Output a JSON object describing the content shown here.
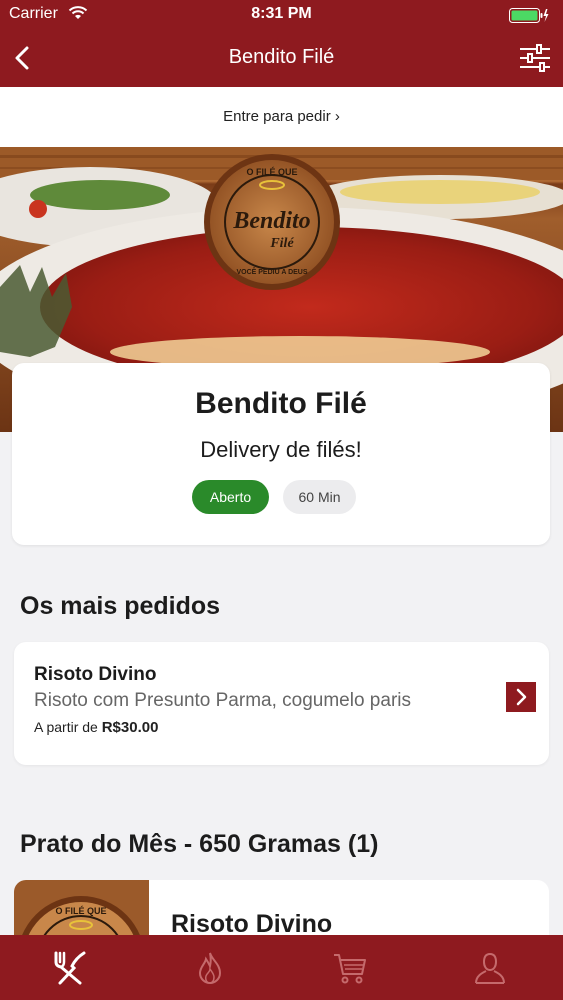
{
  "status_bar": {
    "carrier": "Carrier",
    "time": "8:31 PM"
  },
  "nav": {
    "title": "Bendito Filé",
    "back_icon": "chevron-left-icon",
    "filter_icon": "sliders-icon"
  },
  "login_prompt": "Entre para pedir ›",
  "hero": {
    "logo_top": "O FILÉ QUE",
    "logo_main": "Bendito",
    "logo_sub": "Filé",
    "logo_bottom": "VOCÊ PEDIU A DEUS"
  },
  "restaurant": {
    "name": "Bendito Filé",
    "tagline": "Delivery de filés!",
    "status": "Aberto",
    "delivery_time": "60 Min"
  },
  "sections": {
    "popular_title": "Os mais pedidos",
    "month_title": "Prato do Mês - 650 Gramas (1)"
  },
  "popular_item": {
    "name": "Risoto Divino",
    "description": "Risoto com Presunto Parma, cogumelo paris",
    "price_prefix": "A partir de",
    "price": "R$30.00"
  },
  "month_item": {
    "name": "Risoto Divino",
    "logo_top": "O FILÉ QUE"
  },
  "tabs": [
    {
      "icon": "fork-knife-icon",
      "active": true
    },
    {
      "icon": "flame-icon",
      "active": false
    },
    {
      "icon": "cart-icon",
      "active": false
    },
    {
      "icon": "user-icon",
      "active": false
    }
  ],
  "colors": {
    "brand": "#8e1a1f",
    "open_badge": "#2a8a2a"
  }
}
